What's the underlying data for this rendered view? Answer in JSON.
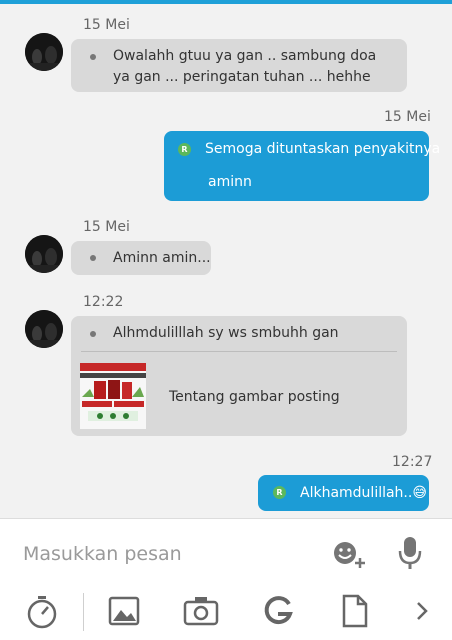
{
  "conversation": {
    "messages": [
      {
        "time": "15 Mei",
        "direction": "incoming",
        "text": "Owalahh gtuu ya gan .. sambung doa ya gan ... peringatan tuhan ... hehhe"
      },
      {
        "time": "15 Mei",
        "direction": "outgoing",
        "text": "Semoga dituntaskan penyakitnya aminn",
        "line1": "Semoga dituntaskan penyakitnya",
        "line2": "aminn"
      },
      {
        "time": "15 Mei",
        "direction": "incoming",
        "text": "Aminn amin..."
      },
      {
        "time": "12:22",
        "direction": "incoming",
        "text": "Alhmdulilllah sy ws smbuhh gan",
        "attachment_title": "Tentang gambar posting"
      },
      {
        "time": "12:27",
        "direction": "outgoing",
        "text": "Alkhamdulillah..",
        "emoji": "😅"
      }
    ],
    "badge_letter": "R"
  },
  "composer": {
    "placeholder": "Masukkan pesan",
    "icons": [
      "emoji-add-icon",
      "microphone-icon"
    ]
  },
  "toolbar": {
    "icons": [
      "timer-icon",
      "image-icon",
      "camera-icon",
      "gif-icon",
      "file-icon",
      "chevron-right-icon"
    ]
  },
  "colors": {
    "accent": "#1c9cd6",
    "incoming_bubble": "#d9d9d9",
    "badge": "#5cb85c"
  }
}
